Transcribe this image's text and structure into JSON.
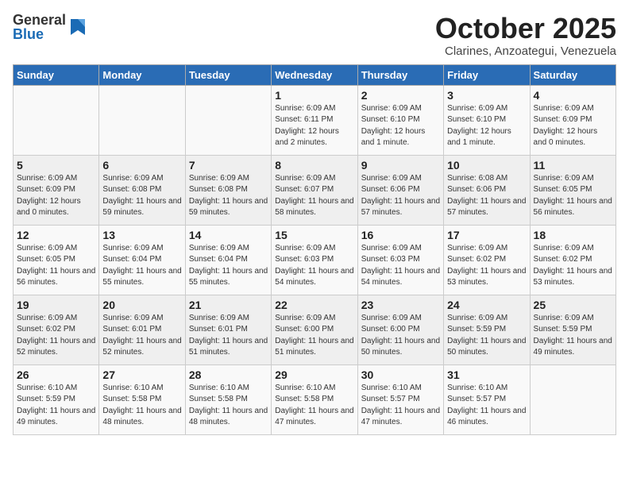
{
  "header": {
    "logo_general": "General",
    "logo_blue": "Blue",
    "title": "October 2025",
    "subtitle": "Clarines, Anzoategui, Venezuela"
  },
  "weekdays": [
    "Sunday",
    "Monday",
    "Tuesday",
    "Wednesday",
    "Thursday",
    "Friday",
    "Saturday"
  ],
  "weeks": [
    [
      {
        "day": "",
        "info": ""
      },
      {
        "day": "",
        "info": ""
      },
      {
        "day": "",
        "info": ""
      },
      {
        "day": "1",
        "info": "Sunrise: 6:09 AM\nSunset: 6:11 PM\nDaylight: 12 hours and 2 minutes."
      },
      {
        "day": "2",
        "info": "Sunrise: 6:09 AM\nSunset: 6:10 PM\nDaylight: 12 hours and 1 minute."
      },
      {
        "day": "3",
        "info": "Sunrise: 6:09 AM\nSunset: 6:10 PM\nDaylight: 12 hours and 1 minute."
      },
      {
        "day": "4",
        "info": "Sunrise: 6:09 AM\nSunset: 6:09 PM\nDaylight: 12 hours and 0 minutes."
      }
    ],
    [
      {
        "day": "5",
        "info": "Sunrise: 6:09 AM\nSunset: 6:09 PM\nDaylight: 12 hours and 0 minutes."
      },
      {
        "day": "6",
        "info": "Sunrise: 6:09 AM\nSunset: 6:08 PM\nDaylight: 11 hours and 59 minutes."
      },
      {
        "day": "7",
        "info": "Sunrise: 6:09 AM\nSunset: 6:08 PM\nDaylight: 11 hours and 59 minutes."
      },
      {
        "day": "8",
        "info": "Sunrise: 6:09 AM\nSunset: 6:07 PM\nDaylight: 11 hours and 58 minutes."
      },
      {
        "day": "9",
        "info": "Sunrise: 6:09 AM\nSunset: 6:06 PM\nDaylight: 11 hours and 57 minutes."
      },
      {
        "day": "10",
        "info": "Sunrise: 6:08 AM\nSunset: 6:06 PM\nDaylight: 11 hours and 57 minutes."
      },
      {
        "day": "11",
        "info": "Sunrise: 6:09 AM\nSunset: 6:05 PM\nDaylight: 11 hours and 56 minutes."
      }
    ],
    [
      {
        "day": "12",
        "info": "Sunrise: 6:09 AM\nSunset: 6:05 PM\nDaylight: 11 hours and 56 minutes."
      },
      {
        "day": "13",
        "info": "Sunrise: 6:09 AM\nSunset: 6:04 PM\nDaylight: 11 hours and 55 minutes."
      },
      {
        "day": "14",
        "info": "Sunrise: 6:09 AM\nSunset: 6:04 PM\nDaylight: 11 hours and 55 minutes."
      },
      {
        "day": "15",
        "info": "Sunrise: 6:09 AM\nSunset: 6:03 PM\nDaylight: 11 hours and 54 minutes."
      },
      {
        "day": "16",
        "info": "Sunrise: 6:09 AM\nSunset: 6:03 PM\nDaylight: 11 hours and 54 minutes."
      },
      {
        "day": "17",
        "info": "Sunrise: 6:09 AM\nSunset: 6:02 PM\nDaylight: 11 hours and 53 minutes."
      },
      {
        "day": "18",
        "info": "Sunrise: 6:09 AM\nSunset: 6:02 PM\nDaylight: 11 hours and 53 minutes."
      }
    ],
    [
      {
        "day": "19",
        "info": "Sunrise: 6:09 AM\nSunset: 6:02 PM\nDaylight: 11 hours and 52 minutes."
      },
      {
        "day": "20",
        "info": "Sunrise: 6:09 AM\nSunset: 6:01 PM\nDaylight: 11 hours and 52 minutes."
      },
      {
        "day": "21",
        "info": "Sunrise: 6:09 AM\nSunset: 6:01 PM\nDaylight: 11 hours and 51 minutes."
      },
      {
        "day": "22",
        "info": "Sunrise: 6:09 AM\nSunset: 6:00 PM\nDaylight: 11 hours and 51 minutes."
      },
      {
        "day": "23",
        "info": "Sunrise: 6:09 AM\nSunset: 6:00 PM\nDaylight: 11 hours and 50 minutes."
      },
      {
        "day": "24",
        "info": "Sunrise: 6:09 AM\nSunset: 5:59 PM\nDaylight: 11 hours and 50 minutes."
      },
      {
        "day": "25",
        "info": "Sunrise: 6:09 AM\nSunset: 5:59 PM\nDaylight: 11 hours and 49 minutes."
      }
    ],
    [
      {
        "day": "26",
        "info": "Sunrise: 6:10 AM\nSunset: 5:59 PM\nDaylight: 11 hours and 49 minutes."
      },
      {
        "day": "27",
        "info": "Sunrise: 6:10 AM\nSunset: 5:58 PM\nDaylight: 11 hours and 48 minutes."
      },
      {
        "day": "28",
        "info": "Sunrise: 6:10 AM\nSunset: 5:58 PM\nDaylight: 11 hours and 48 minutes."
      },
      {
        "day": "29",
        "info": "Sunrise: 6:10 AM\nSunset: 5:58 PM\nDaylight: 11 hours and 47 minutes."
      },
      {
        "day": "30",
        "info": "Sunrise: 6:10 AM\nSunset: 5:57 PM\nDaylight: 11 hours and 47 minutes."
      },
      {
        "day": "31",
        "info": "Sunrise: 6:10 AM\nSunset: 5:57 PM\nDaylight: 11 hours and 46 minutes."
      },
      {
        "day": "",
        "info": ""
      }
    ]
  ]
}
